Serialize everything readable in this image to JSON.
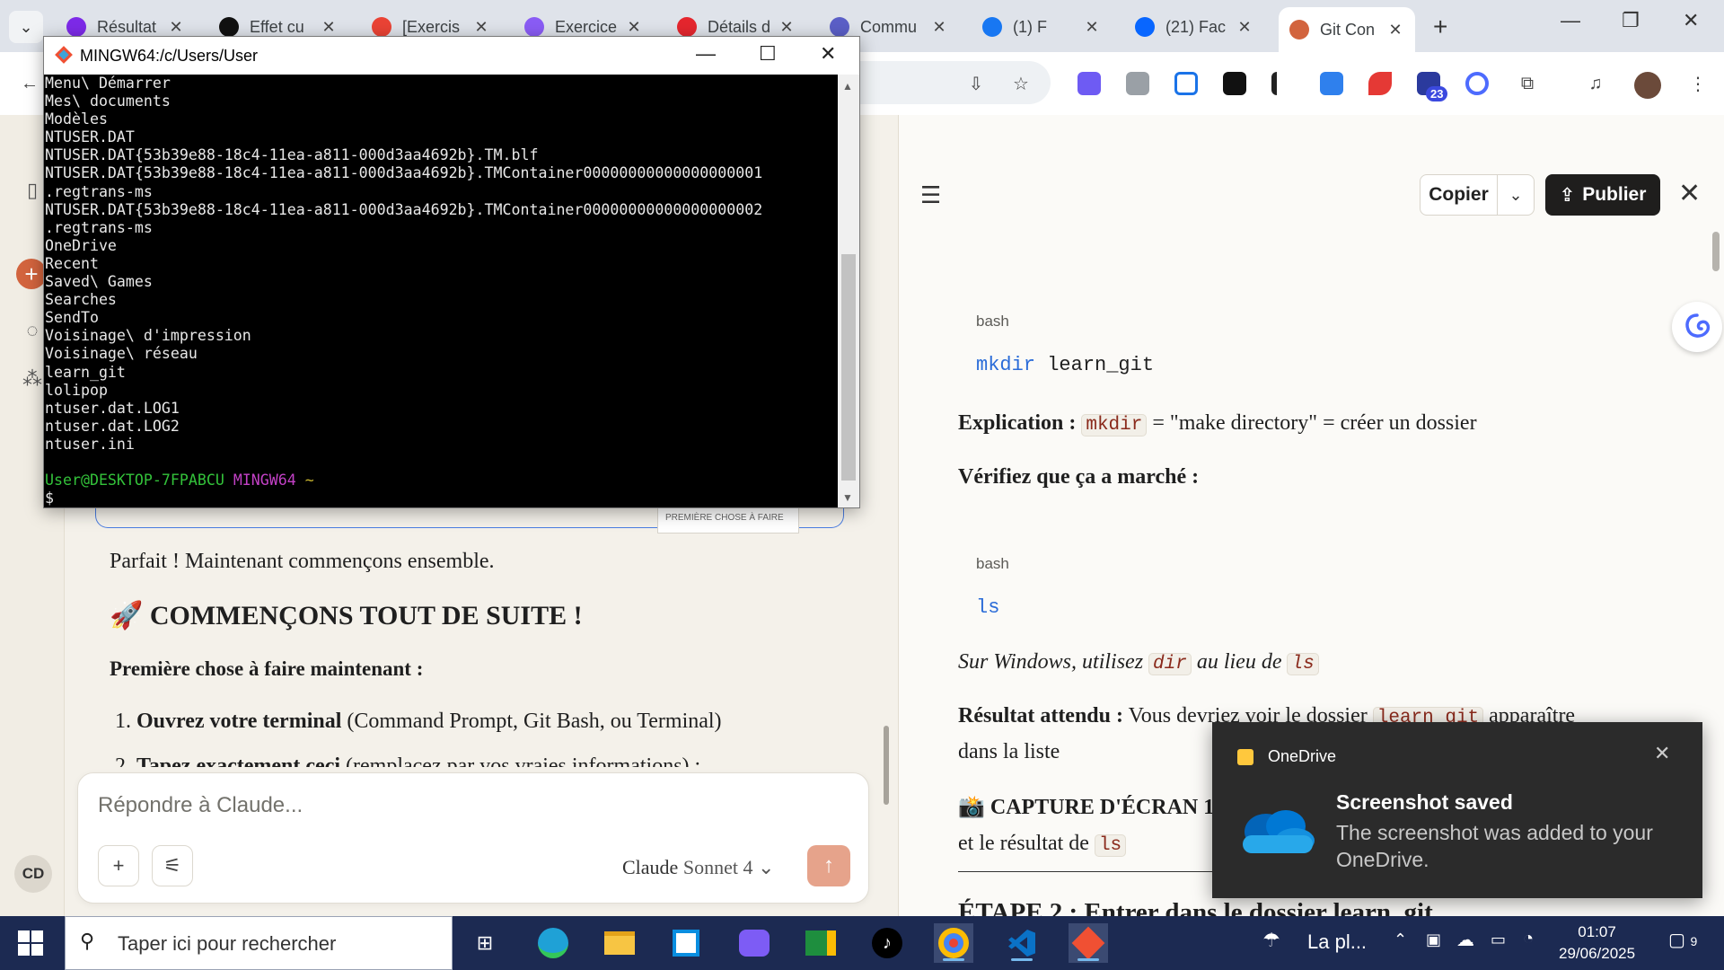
{
  "browser": {
    "tabs": [
      {
        "title": "Résultat",
        "icon": "quiz-icon",
        "color": "#7d2ae8"
      },
      {
        "title": "Effet cu",
        "icon": "openai-icon",
        "color": "#111111"
      },
      {
        "title": "[Exercis",
        "icon": "gmail-icon",
        "color": "#ea4335"
      },
      {
        "title": "Exercice",
        "icon": "form-icon",
        "color": "#8a5cf5"
      },
      {
        "title": "Détails d",
        "icon": "opera-icon",
        "color": "#e5262e"
      },
      {
        "title": "Commu",
        "icon": "c-icon",
        "color": "#5b5fc7"
      },
      {
        "title": "(1) F",
        "icon": "facebook-icon",
        "color": "#1877f2"
      },
      {
        "title": "(21) Fac",
        "icon": "meta-icon",
        "color": "#0866ff"
      },
      {
        "title": "Git Con",
        "icon": "claude-icon",
        "color": "#d2643e"
      }
    ],
    "extension_badge": "23"
  },
  "terminal": {
    "title": "MINGW64:/c/Users/User",
    "lines": [
      "Menu\\ Démarrer",
      "Mes\\ documents",
      "Modèles",
      "NTUSER.DAT",
      "NTUSER.DAT{53b39e88-18c4-11ea-a811-000d3aa4692b}.TM.blf",
      "NTUSER.DAT{53b39e88-18c4-11ea-a811-000d3aa4692b}.TMContainer00000000000000000001",
      ".regtrans-ms",
      "NTUSER.DAT{53b39e88-18c4-11ea-a811-000d3aa4692b}.TMContainer00000000000000000002",
      ".regtrans-ms",
      "OneDrive",
      "Recent",
      "Saved\\ Games",
      "Searches",
      "SendTo",
      "Voisinage\\ d'impression",
      "Voisinage\\ réseau",
      "learn_git",
      "lolipop",
      "ntuser.dat.LOG1",
      "ntuser.dat.LOG2",
      "ntuser.ini",
      ""
    ],
    "prompt_user": "User@DESKTOP-7FPABCU",
    "prompt_system": "MINGW64",
    "prompt_path": "~",
    "prompt_symbol": "$"
  },
  "chat": {
    "thumbnail_caption": "PREMIÈRE CHOSE À FAIRE",
    "para1": "Parfait ! Maintenant commençons ensemble.",
    "heading_emoji": "🚀",
    "heading": "COMMENÇONS TOUT DE SUITE !",
    "subheading": "Première chose à faire maintenant :",
    "item1_bold": "Ouvrez votre terminal",
    "item1_rest": " (Command Prompt, Git Bash, ou Terminal)",
    "item2_bold": "Tapez exactement ceci",
    "item2_rest": " (remplacez par vos vraies informations) :",
    "composer_placeholder": "Répondre à Claude...",
    "model_name": "Claude",
    "model_version": "Sonnet 4",
    "avatar_initials": "CD"
  },
  "artifact": {
    "copy_label": "Copier",
    "publish_label": "Publier",
    "code1_lang": "bash",
    "code1_cmd": "mkdir",
    "code1_arg": " learn_git",
    "explication_label": "Explication :",
    "explication_code": "mkdir",
    "explication_text": " = \"make directory\" = créer un dossier",
    "verify": "Vérifiez que ça a marché :",
    "code2_lang": "bash",
    "code2_cmd": "ls",
    "windows_pre": "Sur Windows, utilisez ",
    "windows_code1": "dir",
    "windows_mid": " au lieu de ",
    "windows_code2": "ls",
    "result_label": "Résultat attendu :",
    "result_text_pre": " Vous devriez voir le dossier ",
    "result_code": "learn_git",
    "result_text_post": " apparaître",
    "result_line2": "dans la liste",
    "capture_emoji": "📸",
    "capture_heading": "CAPTURE D'ÉCRAN 1",
    "capture_line2_pre": "et le résultat de ",
    "capture_code": "ls",
    "step2_heading": "ÉTAPE 2 : Entrer dans le dossier learn_git"
  },
  "toast": {
    "app": "OneDrive",
    "title": "Screenshot saved",
    "body": "The screenshot was added to your OneDrive."
  },
  "taskbar": {
    "search_placeholder": "Taper ici pour rechercher",
    "weather": "La pl...",
    "time": "01:07",
    "date": "29/06/2025",
    "notifications": "9"
  }
}
